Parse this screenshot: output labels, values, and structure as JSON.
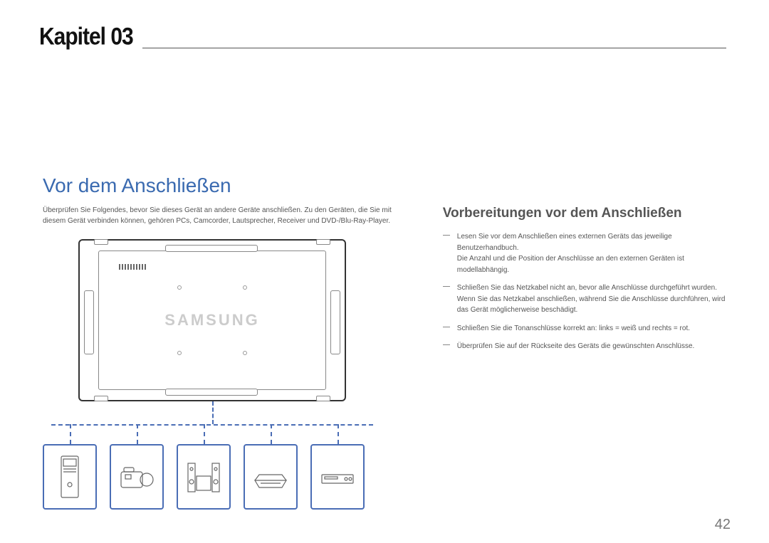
{
  "chapter_label": "Kapitel 03",
  "main_title": "Vor dem Anschließen",
  "intro": "Überprüfen Sie Folgendes, bevor Sie dieses Gerät an andere Geräte anschließen. Zu den Geräten, die Sie mit diesem Gerät verbinden können, gehören PCs, Camcorder, Lautsprecher, Receiver und DVD-/Blu-Ray-Player.",
  "sub_title": "Vorbereitungen vor dem Anschließen",
  "tv_brand": "SAMSUNG",
  "notes": [
    {
      "line1": "Lesen Sie vor dem Anschließen eines externen Geräts das jeweilige Benutzerhandbuch.",
      "line2": "Die Anzahl und die Position der Anschlüsse an den externen Geräten ist modellabhängig."
    },
    {
      "line1": "Schließen Sie das Netzkabel nicht an, bevor alle Anschlüsse durchgeführt wurden.",
      "line2": "Wenn Sie das Netzkabel anschließen, während Sie die Anschlüsse durchführen, wird das Gerät möglicherweise beschädigt."
    },
    {
      "line1": "Schließen Sie die Tonanschlüsse korrekt an: links = weiß und rechts = rot.",
      "line2": ""
    },
    {
      "line1": "Überprüfen Sie auf der Rückseite des Geräts die gewünschten Anschlüsse.",
      "line2": ""
    }
  ],
  "page_number": "42",
  "device_names": [
    "pc-tower-icon",
    "camcorder-icon",
    "speaker-system-icon",
    "receiver-icon",
    "dvd-player-icon"
  ]
}
